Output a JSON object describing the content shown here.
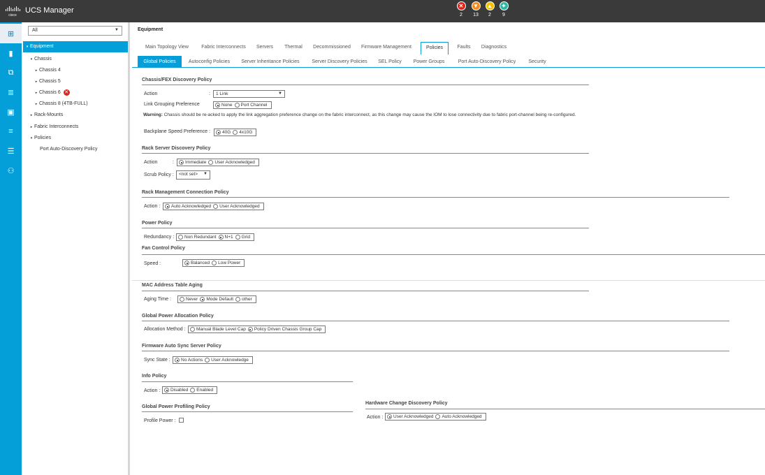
{
  "app": {
    "title": "UCS Manager",
    "logo_text": "cisco"
  },
  "faults": [
    {
      "name": "critical",
      "count": "2",
      "color": "#e2231a",
      "glyph": "✕"
    },
    {
      "name": "major",
      "count": "13",
      "color": "#f58b1f",
      "glyph": "▼"
    },
    {
      "name": "minor",
      "count": "2",
      "color": "#f7c000",
      "glyph": "▲"
    },
    {
      "name": "warning",
      "count": "9",
      "color": "#2db6a6",
      "glyph": "✦"
    }
  ],
  "rail": [
    {
      "icon": "equipment-icon",
      "glyph": "⊞",
      "active": true
    },
    {
      "icon": "servers-icon",
      "glyph": "▮"
    },
    {
      "icon": "lan-icon",
      "glyph": "⧉"
    },
    {
      "icon": "san-icon",
      "glyph": "≣"
    },
    {
      "icon": "vm-icon",
      "glyph": "▣"
    },
    {
      "icon": "storage-icon",
      "glyph": "≡"
    },
    {
      "icon": "chassis-icon",
      "glyph": "☰"
    },
    {
      "icon": "admin-icon",
      "glyph": "⚇"
    }
  ],
  "tree": {
    "filter": "All",
    "items": [
      {
        "label": "Equipment",
        "selected": true,
        "twisty": "▾"
      },
      {
        "label": "Chassis",
        "twisty": "▾"
      },
      {
        "label": "Chassis 4",
        "twisty": "▸"
      },
      {
        "label": "Chassis 5",
        "twisty": "▸"
      },
      {
        "label": "Chassis 6",
        "twisty": "▸",
        "error": true
      },
      {
        "label": "Chassis 8 (4TB-FULL)",
        "twisty": "▸"
      },
      {
        "label": "Rack-Mounts",
        "twisty": "▸"
      },
      {
        "label": "Fabric Interconnects",
        "twisty": "▸"
      },
      {
        "label": "Policies",
        "twisty": "▾"
      },
      {
        "label": "Port Auto-Discovery Policy",
        "twisty": ""
      }
    ]
  },
  "breadcrumb": "Equipment",
  "main_tabs": [
    "Main Topology View",
    "Fabric Interconnects",
    "Servers",
    "Thermal",
    "Decommissioned",
    "Firmware Management",
    "Policies",
    "Faults",
    "Diagnostics"
  ],
  "main_tab_active": "Policies",
  "sub_tabs": [
    "Global Policies",
    "Autoconfig Policies",
    "Server Inheritance Policies",
    "Server Discovery Policies",
    "SEL Policy",
    "Power Groups",
    "Port Auto-Discovery Policy",
    "Security"
  ],
  "sub_tab_active": "Global Policies",
  "sections": {
    "chassis_fex": {
      "title": "Chassis/FEX Discovery Policy",
      "action_label": "Action",
      "colon": ":",
      "action_value": "1 Link",
      "link_grouping_label": "Link Grouping Preference",
      "link_grouping_options": [
        "None",
        "Port Channel"
      ],
      "link_grouping_selected": "None",
      "warning_bold": "Warning:",
      "warning_text": "Chassis should be re-acked to apply the link aggregation preference change on the fabric interconnect, as this change may cause the IOM to lose connectivity due to fabric port-channel being re-configured.",
      "backplane_label": "Backplane Speed Preference :",
      "backplane_options": [
        "40G",
        "4x10G"
      ],
      "backplane_selected": "40G"
    },
    "rack_server": {
      "title": "Rack Server Discovery Policy",
      "action_label": "Action",
      "colon": ":",
      "action_options": [
        "Immediate",
        "User Acknowledged"
      ],
      "action_selected": "Immediate",
      "scrub_label": "Scrub Policy :",
      "scrub_value": "<not set>"
    },
    "rack_mgmt": {
      "title": "Rack Management Connection Policy",
      "action_label": "Action :",
      "options": [
        "Auto Acknowledged",
        "User Acknowledged"
      ],
      "selected": "Auto Acknowledged"
    },
    "power": {
      "title": "Power Policy",
      "label": "Redundancy :",
      "options": [
        "Non Redundant",
        "N+1",
        "Grid"
      ],
      "selected": "N+1"
    },
    "fan": {
      "title": "Fan Control Policy",
      "label": "Speed :",
      "options": [
        "Balanced",
        "Low Power"
      ],
      "selected": "Balanced"
    },
    "mac": {
      "title": "MAC Address Table Aging",
      "label": "Aging Time  :",
      "options": [
        "Never",
        "Mode Default",
        "other"
      ],
      "selected": "Mode Default"
    },
    "global_power": {
      "title": "Global Power Allocation Policy",
      "label": "Allocation Method :",
      "options": [
        "Manual Blade Level Cap",
        "Policy Driven Chassis Group Cap"
      ],
      "selected": "Policy Driven Chassis Group Cap"
    },
    "firmware": {
      "title": "Firmware Auto Sync Server Policy",
      "label": "Sync State :",
      "options": [
        "No Actions",
        "User Acknowledge"
      ],
      "selected": "No Actions"
    },
    "info": {
      "title": "Info Policy",
      "label": "Action :",
      "options": [
        "Disabled",
        "Enabled"
      ],
      "selected": "Disabled"
    },
    "profiling": {
      "title": "Global Power Profiling Policy",
      "label": "Profile Power :"
    },
    "hw_change": {
      "title": "Hardware Change Discovery Policy",
      "label": "Action :",
      "options": [
        "User Acknowledged",
        "Auto Acknowledged"
      ],
      "selected": "User Acknowledged"
    }
  }
}
